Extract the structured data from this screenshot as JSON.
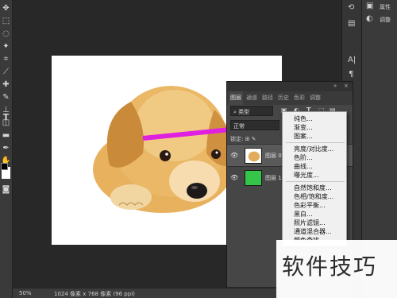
{
  "layers_panel": {
    "tabs": [
      "图层",
      "通道",
      "路径",
      "历史",
      "色彩",
      "调整"
    ],
    "filter_label": "类型",
    "blend_mode": "正常",
    "lock_label": "锁定:",
    "layers": [
      {
        "name": "图层 0",
        "thumb": "puppy",
        "selected": true
      },
      {
        "name": "图层 1",
        "thumb": "green",
        "selected": false
      }
    ]
  },
  "adjust_menu": {
    "items": [
      "纯色...",
      "渐变...",
      "图案...",
      "亮度/对比度...",
      "色阶...",
      "曲线...",
      "曝光度...",
      "自然饱和度...",
      "色相/饱和度...",
      "色彩平衡...",
      "黑白...",
      "照片滤镜...",
      "通道混合器...",
      "颜色查找..."
    ]
  },
  "right_dock": {
    "labels": [
      "属性",
      "调整"
    ]
  },
  "status_bar": {
    "zoom": "50%",
    "doc_info": "1024 像素 x 768 像素 (96 ppi)"
  },
  "watermark": "软件技巧",
  "colors": {
    "arrow": "#e020e0",
    "layer_green": "#34c54a",
    "canvas_bg": "#ffffff",
    "ui_bg": "#282828"
  },
  "icons": [
    "move-icon",
    "marquee-icon",
    "lasso-icon",
    "magic-wand-icon",
    "crop-icon",
    "eyedropper-icon",
    "healing-brush-icon",
    "brush-icon",
    "stamp-icon",
    "history-brush-icon",
    "eraser-icon",
    "gradient-icon",
    "blur-icon",
    "dodge-icon",
    "pen-icon",
    "type-icon",
    "path-select-icon",
    "shape-icon",
    "hand-icon",
    "zoom-icon"
  ]
}
